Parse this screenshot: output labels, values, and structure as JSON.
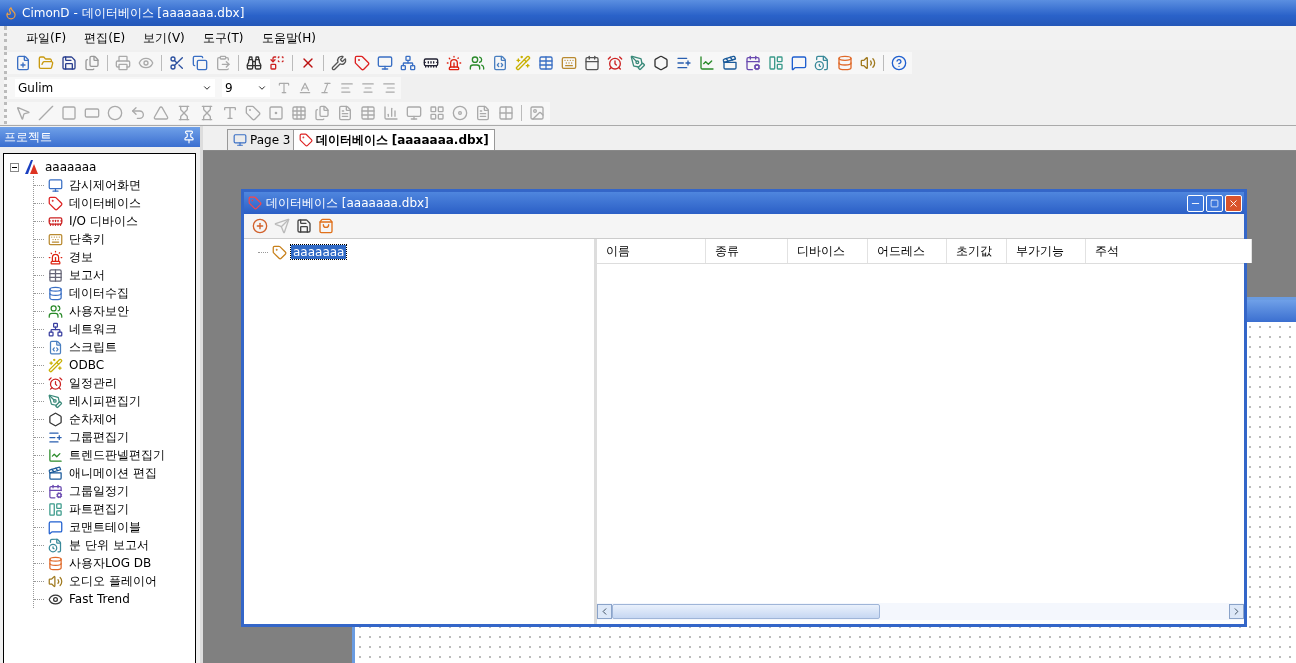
{
  "window": {
    "title": "CimonD - 데이터베이스 [aaaaaaa.dbx]"
  },
  "menu": [
    "파일(F)",
    "편집(E)",
    "보기(V)",
    "도구(T)",
    "도움말(H)"
  ],
  "format_toolbar": {
    "font": "Gulim",
    "size": "9"
  },
  "project_panel": {
    "title": "프로젝트",
    "tree": {
      "label": "aaaaaaa",
      "expanded": true,
      "children": [
        {
          "label": "감시제어화면"
        },
        {
          "label": "데이터베이스"
        },
        {
          "label": "I/O 디바이스"
        },
        {
          "label": "단축키"
        },
        {
          "label": "경보"
        },
        {
          "label": "보고서"
        },
        {
          "label": "데이터수집"
        },
        {
          "label": "사용자보안"
        },
        {
          "label": "네트워크"
        },
        {
          "label": "스크립트"
        },
        {
          "label": "ODBC"
        },
        {
          "label": "일정관리"
        },
        {
          "label": "레시피편집기"
        },
        {
          "label": "순차제어"
        },
        {
          "label": "그룹편집기"
        },
        {
          "label": "트렌드판넬편집기"
        },
        {
          "label": "애니메이션 편집"
        },
        {
          "label": "그룹일정기"
        },
        {
          "label": "파트편집기"
        },
        {
          "label": "코맨트테이블"
        },
        {
          "label": "분 단위 보고서"
        },
        {
          "label": "사용자LOG DB"
        },
        {
          "label": "오디오 플레이어"
        },
        {
          "label": "Fast Trend"
        }
      ]
    }
  },
  "tabs": [
    {
      "label": "Page 3",
      "selected": false
    },
    {
      "label": "데이터베이스 [aaaaaaa.dbx]",
      "selected": true
    }
  ],
  "database_window": {
    "title": "데이터베이스 [aaaaaaa.dbx]",
    "tree": [
      {
        "label": "aaaaaaa",
        "selected": true
      }
    ],
    "table": {
      "columns": [
        "이름",
        "종류",
        "디바이스",
        "어드레스",
        "초기값",
        "부가기능",
        "주석"
      ]
    }
  }
}
